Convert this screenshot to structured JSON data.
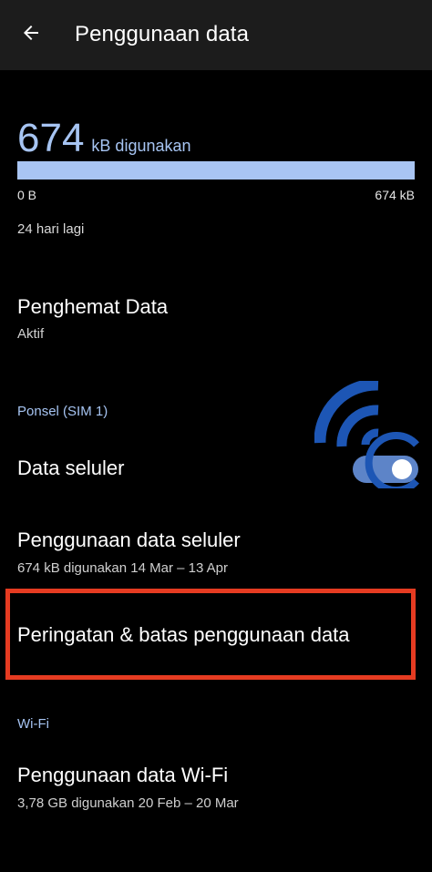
{
  "appbar": {
    "title": "Penggunaan data",
    "back_icon": "arrow-left-icon"
  },
  "usage": {
    "value": "674",
    "unit_label": "kB digunakan",
    "bar_min": "0 B",
    "bar_max": "674 kB",
    "fill_fraction": 1.0,
    "days_left": "24 hari lagi"
  },
  "data_saver": {
    "title": "Penghemat Data",
    "status": "Aktif"
  },
  "sim_section": {
    "header": "Ponsel (SIM 1)",
    "items": [
      {
        "title": "Data seluler"
      },
      {
        "title": "Penggunaan data seluler",
        "subtitle": "674 kB digunakan 14 Mar – 13 Apr"
      },
      {
        "title": "Peringatan & batas penggunaan data"
      }
    ]
  },
  "wifi_section": {
    "header": "Wi-Fi",
    "items": [
      {
        "title": "Penggunaan data Wi-Fi",
        "subtitle": "3,78 GB digunakan 20 Feb – 20 Mar"
      }
    ]
  },
  "colors": {
    "accent": "#a6c4f2",
    "highlight": "#e53b21",
    "appbar_bg": "#1c1c1c",
    "background": "#000000"
  }
}
